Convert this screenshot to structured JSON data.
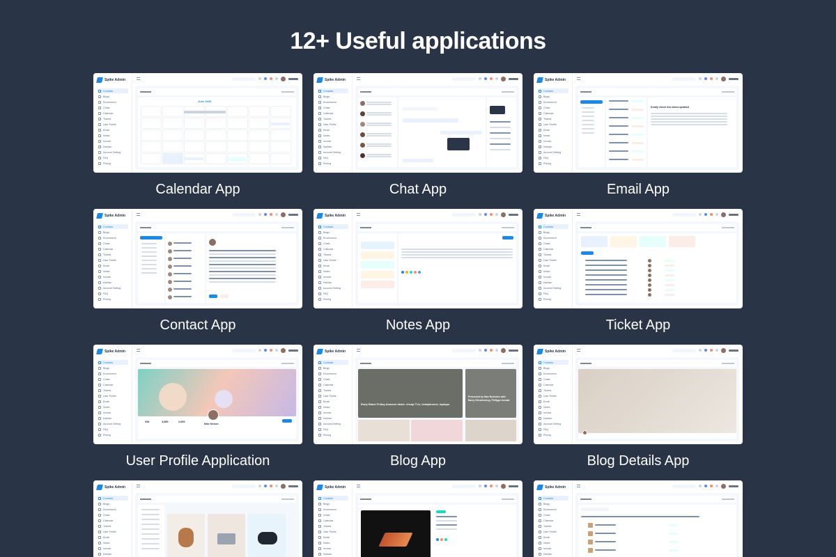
{
  "headline": "12+ Useful applications",
  "brand": {
    "name": "Spike Admin",
    "accent": "#1e88e5",
    "background": "#2a3447"
  },
  "cards": [
    {
      "caption": "Calendar App",
      "kind": "calendar"
    },
    {
      "caption": "Chat App",
      "kind": "chat"
    },
    {
      "caption": "Email App",
      "kind": "email"
    },
    {
      "caption": "Contact App",
      "kind": "contact"
    },
    {
      "caption": "Notes App",
      "kind": "notes"
    },
    {
      "caption": "Ticket App",
      "kind": "ticket"
    },
    {
      "caption": "User Profile Application",
      "kind": "profile"
    },
    {
      "caption": "Blog App",
      "kind": "blog"
    },
    {
      "caption": "Blog Details App",
      "kind": "blogdetail"
    },
    {
      "caption": "",
      "kind": "shop"
    },
    {
      "caption": "",
      "kind": "shopdetail"
    },
    {
      "caption": "",
      "kind": "products"
    }
  ],
  "sidebar_items": [
    "Contacts",
    "Blogs",
    "Ecommerce",
    "Chats",
    "Calendar",
    "Tickets",
    "User Profile",
    "Email",
    "Notes",
    "Invoice",
    "Kanban",
    "Account Setting",
    "FAQ",
    "Pricing"
  ],
  "mini_text": {
    "calendar_month": "June 2023",
    "email_subject": "Kindly check this latest updated",
    "blog_post_1": "Early Black Friday Amazon deals: cheap TVs, headphones, laptops",
    "blog_post_2": "Presented by Max Rushden with Barry Glendenning, Philippe Auclair",
    "blog_detail_title": "Streaming video way before it was cool, go dark tomorrow",
    "profile_name": "Mike Nielsen",
    "profile_stats": [
      "938",
      "3,586",
      "2,659"
    ]
  }
}
